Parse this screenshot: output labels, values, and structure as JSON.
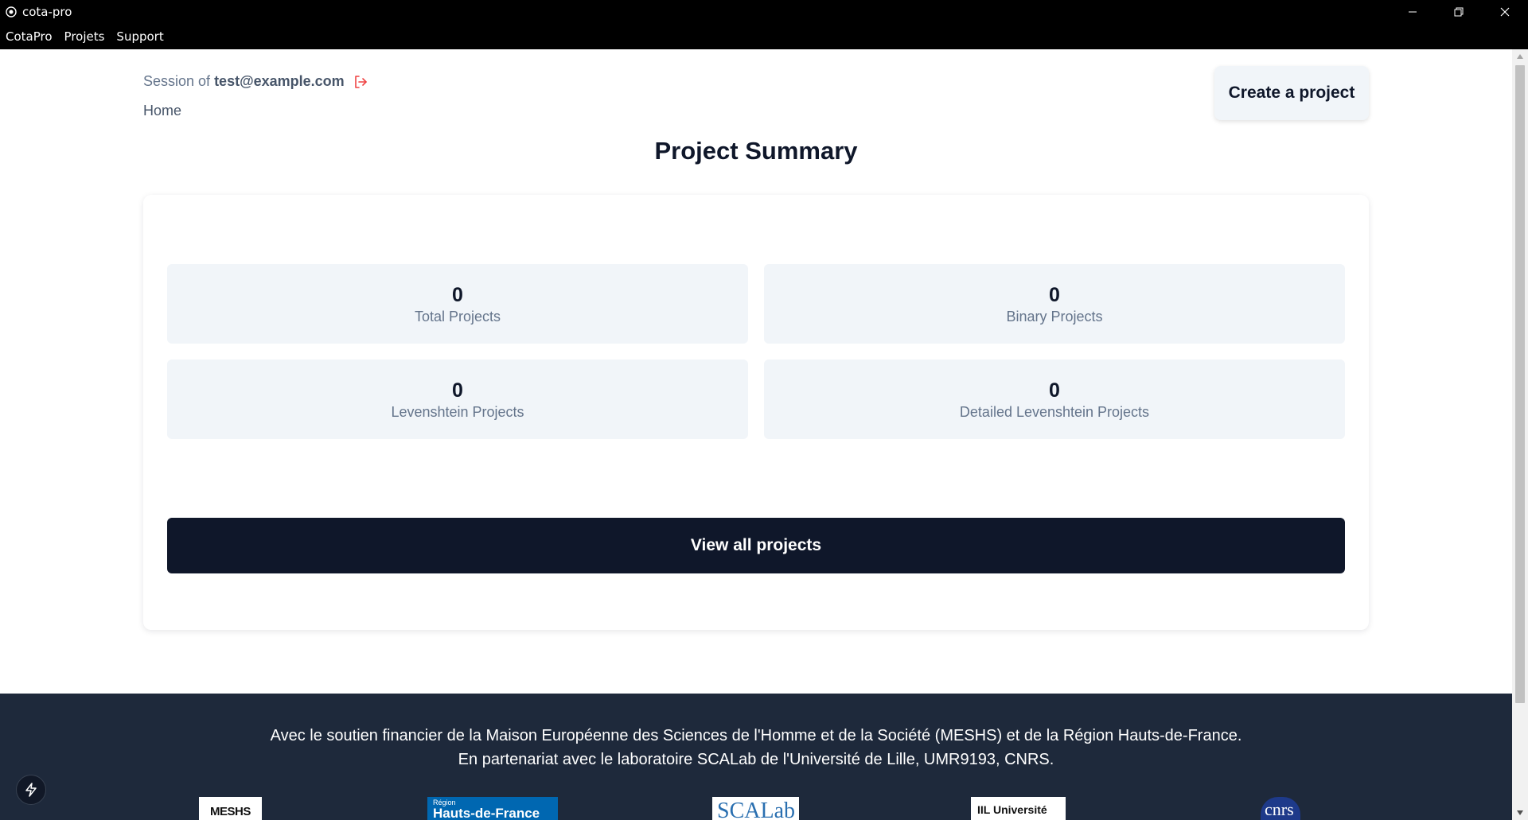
{
  "window": {
    "title": "cota-pro"
  },
  "menu": {
    "items": [
      "CotaPro",
      "Projets",
      "Support"
    ]
  },
  "session": {
    "prefix": "Session of",
    "email": "test@example.com"
  },
  "breadcrumb": "Home",
  "header": {
    "create_label": "Create a project",
    "title": "Project Summary"
  },
  "stats": [
    {
      "value": "0",
      "label": "Total Projects"
    },
    {
      "value": "0",
      "label": "Binary Projects"
    },
    {
      "value": "0",
      "label": "Levenshtein Projects"
    },
    {
      "value": "0",
      "label": "Detailed Levenshtein Projects"
    }
  ],
  "actions": {
    "view_all_label": "View all projects"
  },
  "footer": {
    "line1": "Avec le soutien financier de la Maison Européenne des Sciences de l'Homme et de la Société (MESHS) et de la Région Hauts-de-France.",
    "line2": "En partenariat avec le laboratoire SCALab de l'Université de Lille, UMR9193, CNRS.",
    "logos": {
      "meshs": "MESHS",
      "hdf_small": "Région",
      "hdf_big": "Hauts-de-France",
      "scalab": "SCALab",
      "lille": "IIL Université",
      "cnrs": "cnrs"
    }
  },
  "colors": {
    "primary": "#0f172a",
    "footer_bg": "#1e293b",
    "stat_bg": "#f1f5f9",
    "logout_icon": "#ef4444"
  }
}
